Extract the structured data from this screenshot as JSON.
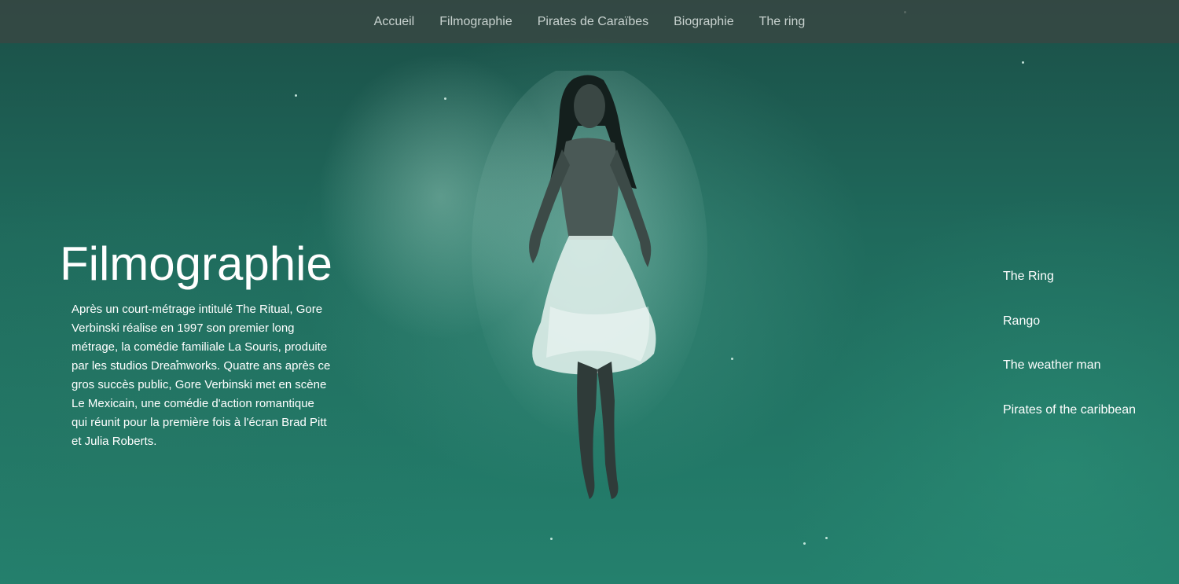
{
  "nav": {
    "items": [
      {
        "label": "Accueil"
      },
      {
        "label": "Filmographie"
      },
      {
        "label": "Pirates de Caraïbes"
      },
      {
        "label": "Biographie"
      },
      {
        "label": "The ring"
      }
    ]
  },
  "hero": {
    "title": "Filmographie",
    "paragraph": "Après un court-métrage intitulé The Ritual, Gore Verbinski réalise en 1997 son premier long métrage, la comédie familiale La Souris, produite par les studios Dreamworks. Quatre ans après ce gros succès public, Gore Verbinski met en scène Le Mexicain, une comédie d'action romantique qui réunit pour la première fois à l'écran Brad Pitt et Julia Roberts."
  },
  "films": {
    "items": [
      {
        "label": "The Ring"
      },
      {
        "label": "Rango"
      },
      {
        "label": "The weather man"
      },
      {
        "label": "Pirates of the caribbean"
      }
    ]
  },
  "colors": {
    "nav_bg": "#3a4643",
    "nav_text": "#c9d3d0",
    "water": "#1f6b5e",
    "text": "#ffffff"
  }
}
